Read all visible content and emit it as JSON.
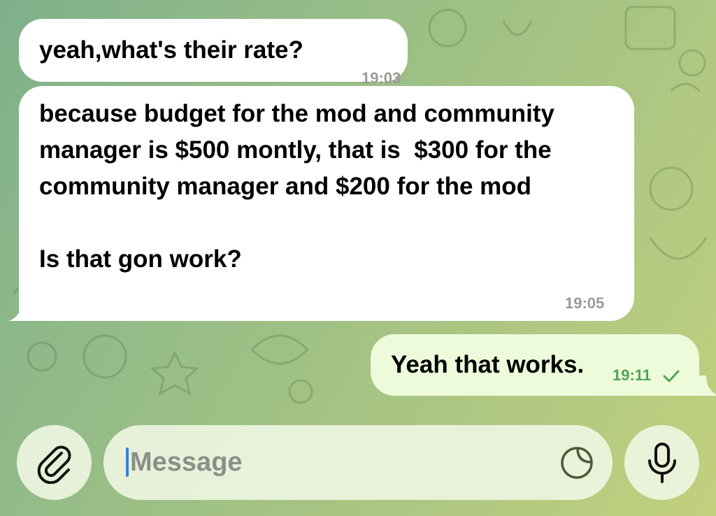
{
  "messages": [
    {
      "direction": "incoming",
      "text": "yeah,what's their rate?",
      "time": "19:03"
    },
    {
      "direction": "incoming",
      "text": "because budget for the mod and community manager is $500 montly, that is  $300 for the community manager and $200 for the mod\n\nIs that gon work?",
      "time": "19:05"
    },
    {
      "direction": "outgoing",
      "text": "Yeah that works.",
      "time": "19:11",
      "status": "read-check"
    }
  ],
  "composer": {
    "placeholder": "Message",
    "value": "",
    "attach_icon": "paperclip-icon",
    "sticker_icon": "sticker-icon",
    "mic_icon": "microphone-icon"
  },
  "colors": {
    "incoming_bubble": "#ffffff",
    "outgoing_bubble": "#eefbdb",
    "outgoing_time": "#4fa553",
    "caret": "#3a7de0"
  }
}
